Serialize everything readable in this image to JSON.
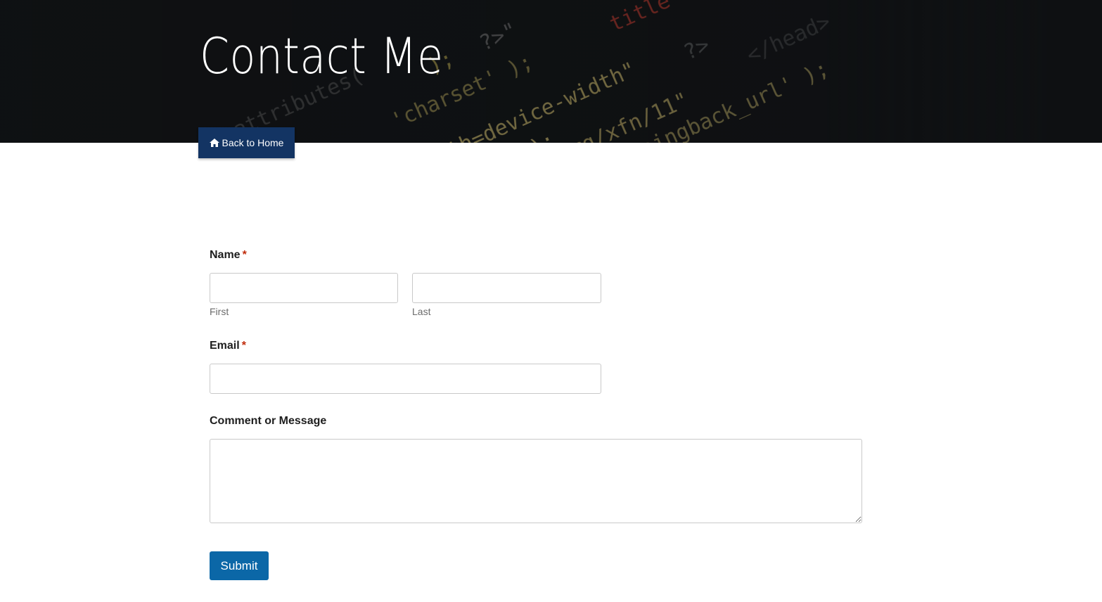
{
  "page": {
    "title": "Contact Me",
    "back_button": {
      "label": "Back to Home",
      "icon": "home-icon"
    }
  },
  "form": {
    "name": {
      "label": "Name",
      "required_marker": "*",
      "first": {
        "sublabel": "First",
        "value": ""
      },
      "last": {
        "sublabel": "Last",
        "value": ""
      }
    },
    "email": {
      "label": "Email",
      "required_marker": "*",
      "value": ""
    },
    "message": {
      "label": "Comment or Message",
      "value": ""
    },
    "submit_label": "Submit"
  },
  "colors": {
    "hero_background": "#0f1113",
    "back_button": "#133463",
    "submit_button": "#0b67a7",
    "required_marker": "#c02b0a"
  }
}
